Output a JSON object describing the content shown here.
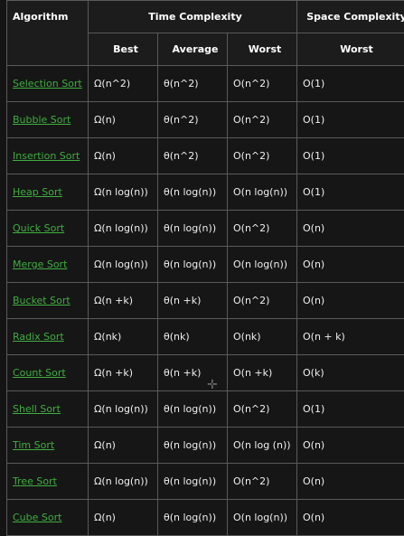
{
  "headers": {
    "algorithm": "Algorithm",
    "time_complexity": "Time Complexity",
    "space_complexity": "Space Complexity",
    "best": "Best",
    "average": "Average",
    "worst": "Worst",
    "space_worst": "Worst"
  },
  "rows": [
    {
      "name": "Selection Sort",
      "best": "Ω(n^2)",
      "average": "θ(n^2)",
      "worst": "O(n^2)",
      "space": "O(1)"
    },
    {
      "name": "Bubble Sort",
      "best": "Ω(n)",
      "average": "θ(n^2)",
      "worst": "O(n^2)",
      "space": "O(1)"
    },
    {
      "name": "Insertion Sort",
      "best": "Ω(n)",
      "average": "θ(n^2)",
      "worst": "O(n^2)",
      "space": "O(1)"
    },
    {
      "name": "Heap Sort",
      "best": "Ω(n log(n))",
      "average": "θ(n log(n))",
      "worst": "O(n log(n))",
      "space": "O(1)"
    },
    {
      "name": "Quick Sort",
      "best": "Ω(n log(n))",
      "average": "θ(n log(n))",
      "worst": "O(n^2)",
      "space": "O(n)"
    },
    {
      "name": "Merge Sort",
      "best": "Ω(n log(n))",
      "average": "θ(n log(n))",
      "worst": "O(n log(n))",
      "space": "O(n)"
    },
    {
      "name": "Bucket Sort",
      "best": "Ω(n +k)",
      "average": "θ(n +k)",
      "worst": "O(n^2)",
      "space": "O(n)"
    },
    {
      "name": "Radix Sort",
      "best": "Ω(nk)",
      "average": "θ(nk)",
      "worst": "O(nk)",
      "space": "O(n + k)"
    },
    {
      "name": "Count Sort",
      "best": "Ω(n +k)",
      "average": "θ(n +k)",
      "worst": "O(n +k)",
      "space": "O(k)"
    },
    {
      "name": "Shell Sort",
      "best": "Ω(n log(n))",
      "average": "θ(n log(n))",
      "worst": "O(n^2)",
      "space": "O(1)"
    },
    {
      "name": "Tim Sort",
      "best": "Ω(n)",
      "average": "θ(n log(n))",
      "worst": "O(n log (n))",
      "space": "O(n)"
    },
    {
      "name": "Tree Sort",
      "best": "Ω(n log(n))",
      "average": "θ(n log(n))",
      "worst": "O(n^2)",
      "space": "O(n)"
    },
    {
      "name": "Cube Sort",
      "best": "Ω(n)",
      "average": "θ(n log(n))",
      "worst": "O(n log(n))",
      "space": "O(n)"
    }
  ],
  "colors": {
    "background": "#141414",
    "border": "#5a5a5a",
    "link": "#3fae3f",
    "text": "#f0f0f0"
  },
  "icons": {
    "cursor": "move-cursor-icon"
  }
}
